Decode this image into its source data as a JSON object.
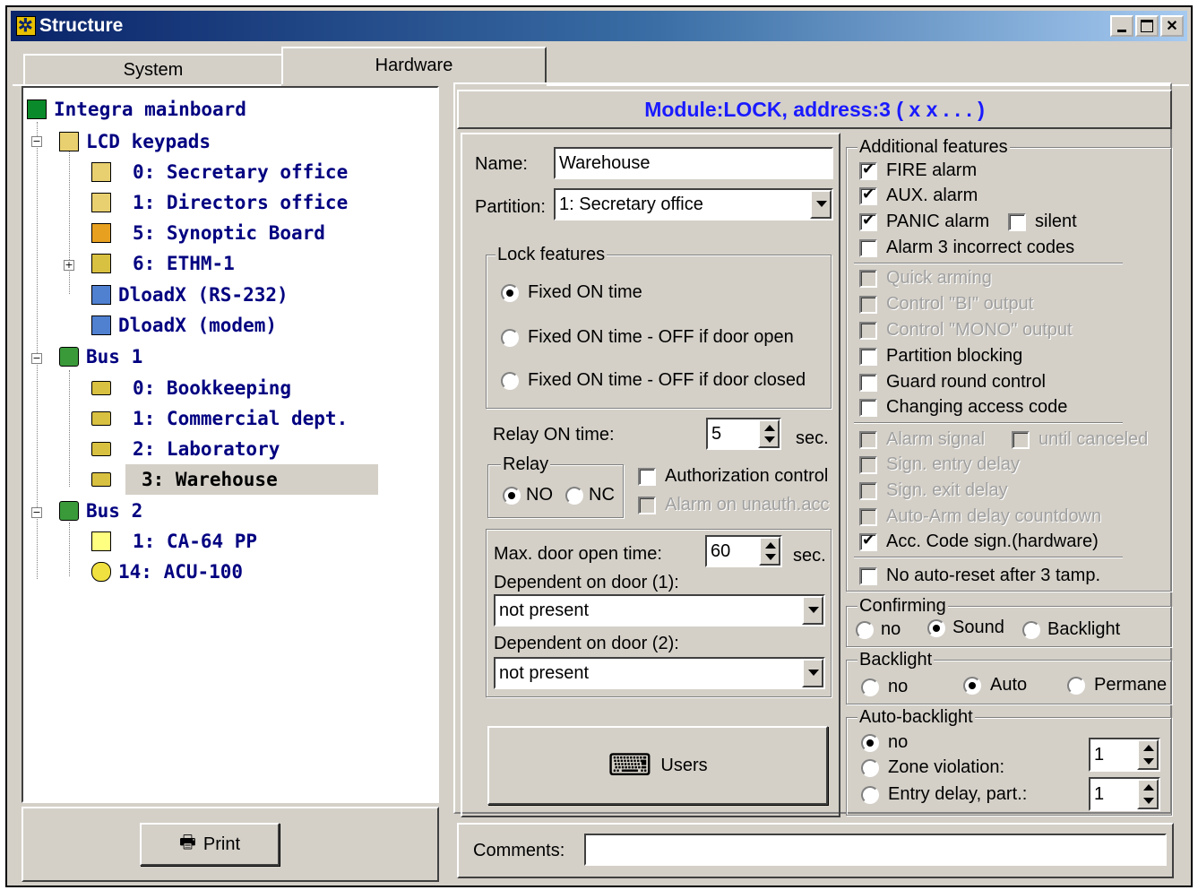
{
  "window": {
    "title": "Structure"
  },
  "tabs": [
    "System",
    "Hardware"
  ],
  "tree": {
    "root": "Integra mainboard",
    "lcd": "LCD keypads",
    "items": [
      "0: Secretary office",
      "1: Directors office",
      "5: Synoptic Board",
      "6: ETHM-1"
    ],
    "dload1": "DloadX (RS-232)",
    "dload2": "DloadX (modem)",
    "bus1": "Bus 1",
    "bus1_items": [
      "0: Bookkeeping",
      "1: Commercial dept.",
      "2: Laboratory",
      "3: Warehouse"
    ],
    "bus2": "Bus 2",
    "bus2_items": [
      "1: CA-64 PP",
      "14: ACU-100"
    ]
  },
  "print_label": "Print",
  "header": "Module:LOCK, address:3 ( x x . . . )",
  "form": {
    "name_label": "Name:",
    "name_value": "Warehouse",
    "partition_label": "Partition:",
    "partition_value": "1: Secretary office",
    "lock_features": "Lock features",
    "lock_opts": [
      "Fixed ON time",
      "Fixed ON time - OFF if door open",
      "Fixed ON time - OFF if door closed"
    ],
    "relay_on_label": "Relay ON time:",
    "relay_on_value": "5",
    "sec": "sec.",
    "relay": "Relay",
    "no": "NO",
    "nc": "NC",
    "auth_control": "Authorization control",
    "alarm_unauth": "Alarm on unauth.acc",
    "max_door_label": "Max. door open time:",
    "max_door_value": "60",
    "dep1_label": "Dependent on door (1):",
    "dep1_value": "not present",
    "dep2_label": "Dependent on door (2):",
    "dep2_value": "not present",
    "users": "Users",
    "comments_label": "Comments:"
  },
  "features": {
    "title": "Additional features",
    "fire": "FIRE alarm",
    "aux": "AUX. alarm",
    "panic": "PANIC alarm",
    "silent": "silent",
    "alarm3": "Alarm 3 incorrect codes",
    "quick": "Quick arming",
    "bi": "Control \"BI\" output",
    "mono": "Control \"MONO\" output",
    "pblock": "Partition blocking",
    "guard": "Guard round control",
    "changing": "Changing access code",
    "alarm_signal": "Alarm signal",
    "until": "until canceled",
    "entry": "Sign. entry delay",
    "exit": "Sign. exit delay",
    "autoarm": "Auto-Arm delay countdown",
    "acc": "Acc. Code sign.(hardware)",
    "noauto": "No auto-reset after 3 tamp."
  },
  "confirming": {
    "title": "Confirming",
    "opts": [
      "no",
      "Sound",
      "Backlight"
    ]
  },
  "backlight": {
    "title": "Backlight",
    "opts": [
      "no",
      "Auto",
      "Permane"
    ]
  },
  "autobacklight": {
    "title": "Auto-backlight",
    "opts": [
      "no",
      "Zone violation:",
      "Entry delay, part.:"
    ],
    "v1": "1",
    "v2": "1"
  }
}
